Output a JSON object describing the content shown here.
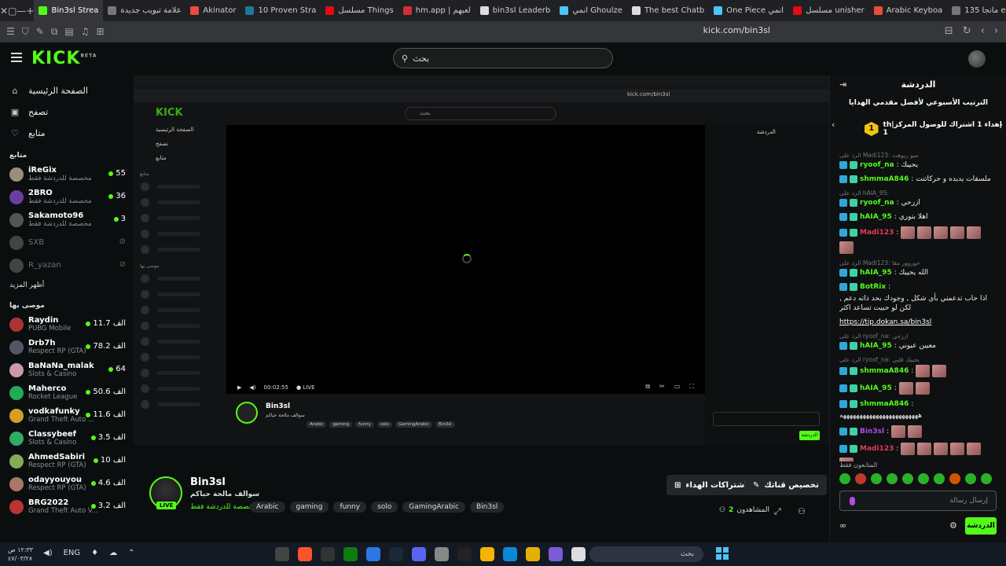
{
  "browser": {
    "tabs": [
      {
        "label": "Bin3sl Strea",
        "color": "#53fc18",
        "active": true
      },
      {
        "label": "علامة تبويب جديدة",
        "color": "#777"
      },
      {
        "label": "Akinator",
        "color": "#e74c3c"
      },
      {
        "label": "10 Proven Stra",
        "color": "#21759b"
      },
      {
        "label": "مسلسل Things",
        "color": "#e50914"
      },
      {
        "label": "hm.app | لعبهم",
        "color": "#d32f2f"
      },
      {
        "label": "bin3sl Leaderb",
        "color": "#ddd"
      },
      {
        "label": "انمي Ghoulze",
        "color": "#4fc3f7"
      },
      {
        "label": "The best Chatb",
        "color": "#ddd"
      },
      {
        "label": "One Piece انمي",
        "color": "#4fc3f7"
      },
      {
        "label": "مسلسل unisher",
        "color": "#e50914"
      },
      {
        "label": "Arabic Keyboa",
        "color": "#e74c3c"
      },
      {
        "label": "مانجا 135 eling",
        "color": "#777"
      }
    ],
    "url": "kick.com/bin3sl"
  },
  "header": {
    "logo": "KICK",
    "logo_tag": "BETA",
    "search_placeholder": "بحث"
  },
  "sidebar": {
    "nav": [
      {
        "label": "الصفحة الرئيسية",
        "icon": "home-icon"
      },
      {
        "label": "تصفح",
        "icon": "browse-icon"
      },
      {
        "label": "متابع",
        "icon": "heart-icon"
      }
    ],
    "following_title": "متابع",
    "following": [
      {
        "name": "iReGix",
        "sub": "مخصصة للدردشة فقط",
        "viewers": "55",
        "color": "#9c8f7a"
      },
      {
        "name": "2BRO",
        "sub": "مخصصة للدردشة فقط",
        "viewers": "36",
        "color": "#6b3fa0"
      },
      {
        "name": "Sakamoto96",
        "sub": "مخصصة للدردشة فقط",
        "viewers": "3",
        "color": "#555"
      },
      {
        "name": "SXB",
        "sub": "",
        "viewers": "",
        "color": "#444",
        "offline": true
      },
      {
        "name": "R_yazan",
        "sub": "",
        "viewers": "",
        "color": "#444",
        "offline": true
      }
    ],
    "show_more": "أظهر المزيد",
    "recommended_title": "موصى بها",
    "recommended": [
      {
        "name": "Raydin",
        "sub": "PUBG Mobile",
        "viewers": "11.7 الف",
        "color": "#a33"
      },
      {
        "name": "Drb7h",
        "sub": "Respect RP (GTA)",
        "viewers": "78.2 الف",
        "color": "#556"
      },
      {
        "name": "BaNaNa_malak",
        "sub": "Slots & Casino",
        "viewers": "64",
        "color": "#c9a"
      },
      {
        "name": "Maherco",
        "sub": "Rocket League",
        "viewers": "50.6 الف",
        "color": "#2a5"
      },
      {
        "name": "vodkafunky",
        "sub": "Grand Theft Auto ...",
        "viewers": "11.6 الف",
        "color": "#d5a021"
      },
      {
        "name": "Classybeef",
        "sub": "Slots & Casino",
        "viewers": "3.5 الف",
        "color": "#3a6"
      },
      {
        "name": "AhmedSabiri",
        "sub": "Respect RP (GTA)",
        "viewers": "10 الف",
        "color": "#8a5"
      },
      {
        "name": "odayyouyou",
        "sub": "Respect RP (GTA)",
        "viewers": "4.6 الف",
        "color": "#a76"
      },
      {
        "name": "BRG2022",
        "sub": "Grand Theft Auto V...",
        "viewers": "3.2 الف",
        "color": "#b33"
      }
    ]
  },
  "player": {
    "time": "00:02:55",
    "live": "LIVE"
  },
  "stream": {
    "name": "Bin3sl",
    "title": "سوالف مالحة حياكم",
    "lang": "مخصصة للدردشة فقط",
    "live": "LIVE",
    "tags": [
      "Arabic",
      "gaming",
      "funny",
      "solo",
      "GamingArabic",
      "Bin3sl"
    ],
    "customize_btn": "تخصيص قناتك",
    "gift_btn": "الاشتراكات الهداء",
    "viewers_label": "المشاهدون",
    "viewers": "2"
  },
  "chat": {
    "title": "الدردشة",
    "leaderboard_title": "الترتيب الأسبوعي لأفضل مقدمي الهدايا",
    "leader_rank": "1",
    "leader_text": "th|إهداء 1 اشتراك للوصول المركز 1",
    "messages": [
      {
        "reply": "الرد على Madi123: مبو ريوهت",
        "user": "ryoof_na",
        "color": "#53fc18",
        "text": "يحييك"
      },
      {
        "reply": "",
        "user": "shmmaA846",
        "color": "#53fc18",
        "text": "ملسقات يديده و حركاتتت"
      },
      {
        "reply": "الرد على hAIA_95:",
        "user": "ryoof_na",
        "color": "#53fc18",
        "text": "ازرحي"
      },
      {
        "reply": "",
        "user": "hAIA_95",
        "color": "#53fc18",
        "text": "اهلا بتوري"
      },
      {
        "reply": "",
        "user": "Madi123",
        "color": "#e23b5a",
        "text": ""
      },
      {
        "reply": "الرد على Madi123: حوروور مقا",
        "user": "hAIA_95",
        "color": "#53fc18",
        "text": "الله يحييك"
      },
      {
        "reply": "",
        "user": "BotRix",
        "color": "#53fc18",
        "text": "اذا حاب تدعمني بأي شكل , وجودك بحد ذاته دعم , لكن لو حبيت تساعد اكثر"
      },
      {
        "reply": "",
        "user": "",
        "color": "#fff",
        "text": "https://tip.dokan.sa/bin3sl"
      },
      {
        "reply": "الرد على ryoof_na: ازرحي",
        "user": "hAIA_95",
        "color": "#53fc18",
        "text": "معيين عيوني"
      },
      {
        "reply": "الرد على ryoof_na: يحييك قلبي",
        "user": "shmmaA846",
        "color": "#53fc18",
        "text": ""
      },
      {
        "reply": "",
        "user": "hAIA_95",
        "color": "#53fc18",
        "text": ""
      },
      {
        "reply": "",
        "user": "shmmaA846",
        "color": "#53fc18",
        "text": "ههههههههههههههههههههههههه"
      },
      {
        "reply": "",
        "user": "Bin3sl",
        "color": "#b14ce0",
        "text": ""
      },
      {
        "reply": "",
        "user": "Madi123",
        "color": "#e23b5a",
        "text": ""
      }
    ],
    "followers_only": "المتابعون فقط",
    "input_placeholder": "إرسال رسالة",
    "send_label": "الدردشة"
  },
  "taskbar": {
    "time": "١٢:٣٣ ص",
    "date": "٤٧/٠٣/٢٨",
    "lang": "ENG",
    "search": "بحث"
  }
}
